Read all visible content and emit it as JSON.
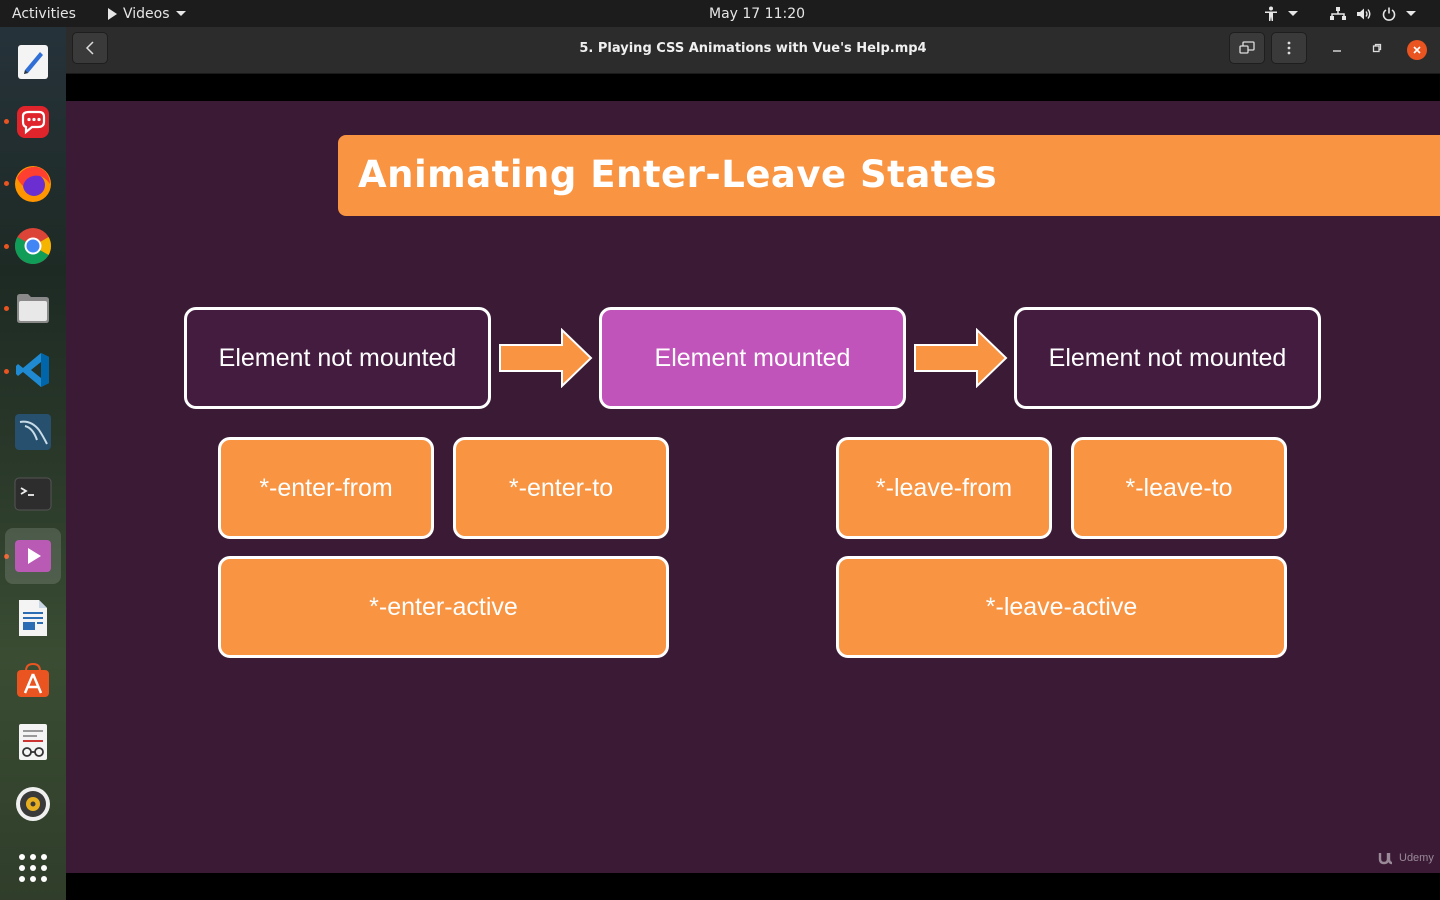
{
  "topbar": {
    "activities": "Activities",
    "app_menu": "Videos",
    "clock": "May 17  11:20"
  },
  "window": {
    "title": "5. Playing CSS Animations with Vue's Help.mp4"
  },
  "slide": {
    "title": "Animating Enter-Leave States",
    "states": [
      "Element not mounted",
      "Element mounted",
      "Element not mounted"
    ],
    "enter": {
      "from": "*-enter-from",
      "to": "*-enter-to",
      "active": "*-enter-active"
    },
    "leave": {
      "from": "*-leave-from",
      "to": "*-leave-to",
      "active": "*-leave-active"
    },
    "watermark": "Udemy"
  },
  "colors": {
    "slide_bg": "#3b1a36",
    "orange": "#f89442",
    "purple": "#c154ba",
    "dark_box": "#431c40",
    "ubuntu_orange": "#e95420"
  },
  "dock": {
    "items": [
      "text-editor-icon",
      "chat-app-icon",
      "firefox-icon",
      "chrome-icon",
      "files-icon",
      "vscode-icon",
      "mysql-workbench-icon",
      "terminal-icon",
      "videos-icon",
      "writer-icon",
      "software-center-icon",
      "document-viewer-icon",
      "rhythmbox-icon",
      "show-apps-icon"
    ]
  }
}
